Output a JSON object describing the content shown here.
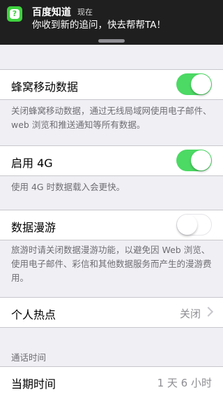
{
  "notification": {
    "app_name": "百度知道",
    "time": "现在",
    "message": "你收到新的追问，快去帮帮TA！",
    "icon": "baidu-zhidao-icon"
  },
  "cellular_data": {
    "label": "蜂窝移动数据",
    "enabled": true,
    "footer": "关闭蜂窝移动数据，通过无线局域网使用电子邮件、web 浏览和推送通知等所有数据。"
  },
  "enable_4g": {
    "label": "启用 4G",
    "enabled": true,
    "footer": "使用 4G 时数据载入会更快。"
  },
  "data_roaming": {
    "label": "数据漫游",
    "enabled": false,
    "footer": "旅游时请关闭数据漫游功能，以避免因 Web 浏览、使用电子邮件、彩信和其他数据服务而产生的漫游费用。"
  },
  "personal_hotspot": {
    "label": "个人热点",
    "value": "关闭"
  },
  "call_time": {
    "header": "通话时间",
    "current_period_label": "当期时间",
    "current_period_value": "1 天 6 小时"
  },
  "colors": {
    "toggle_on": "#4cd964",
    "background": "#efeff4"
  }
}
